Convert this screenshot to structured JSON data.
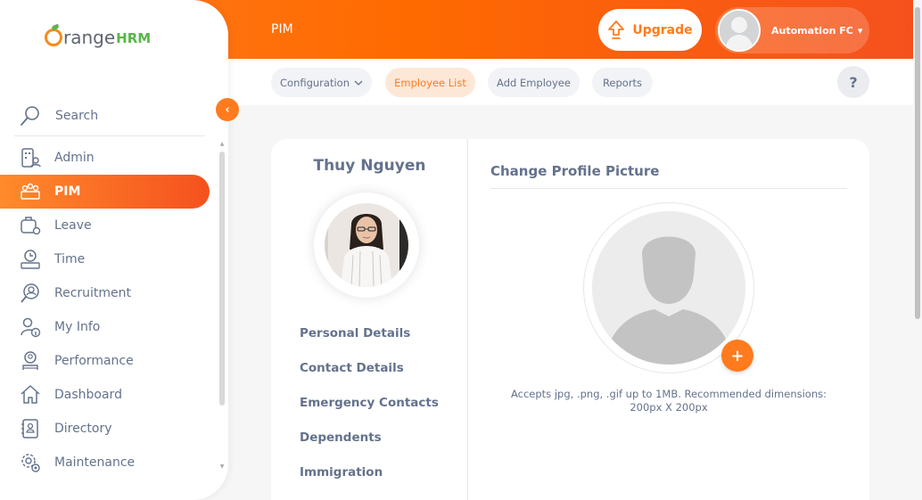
{
  "header": {
    "module_title": "PIM",
    "upgrade_label": "Upgrade",
    "user_name": "Automation FC",
    "user_caret": "▾"
  },
  "subnav": {
    "items": [
      {
        "label": "Configuration",
        "has_dropdown": true
      },
      {
        "label": "Employee List",
        "active": true
      },
      {
        "label": "Add Employee"
      },
      {
        "label": "Reports"
      }
    ],
    "help_label": "?"
  },
  "sidebar": {
    "brand": {
      "orange": "range",
      "hrm": "HRM"
    },
    "collapse_glyph": "‹",
    "search_label": "Search",
    "items": [
      {
        "label": "Admin",
        "icon": "admin-icon"
      },
      {
        "label": "PIM",
        "icon": "pim-icon",
        "active": true
      },
      {
        "label": "Leave",
        "icon": "leave-icon"
      },
      {
        "label": "Time",
        "icon": "time-icon"
      },
      {
        "label": "Recruitment",
        "icon": "recruitment-icon"
      },
      {
        "label": "My Info",
        "icon": "my-info-icon"
      },
      {
        "label": "Performance",
        "icon": "performance-icon"
      },
      {
        "label": "Dashboard",
        "icon": "dashboard-icon"
      },
      {
        "label": "Directory",
        "icon": "directory-icon"
      },
      {
        "label": "Maintenance",
        "icon": "maintenance-icon"
      }
    ]
  },
  "employee": {
    "name": "Thuy Nguyen"
  },
  "profile_tabs": [
    "Personal Details",
    "Contact Details",
    "Emergency Contacts",
    "Dependents",
    "Immigration"
  ],
  "profile_picture": {
    "title": "Change Profile Picture",
    "add_glyph": "+",
    "hint": "Accepts jpg, .png, .gif up to 1MB. Recommended dimensions: 200px X 200px"
  },
  "colors": {
    "brand_orange": "#ff7b1d",
    "brand_green": "#59b64a",
    "text_gray": "#64728c"
  }
}
